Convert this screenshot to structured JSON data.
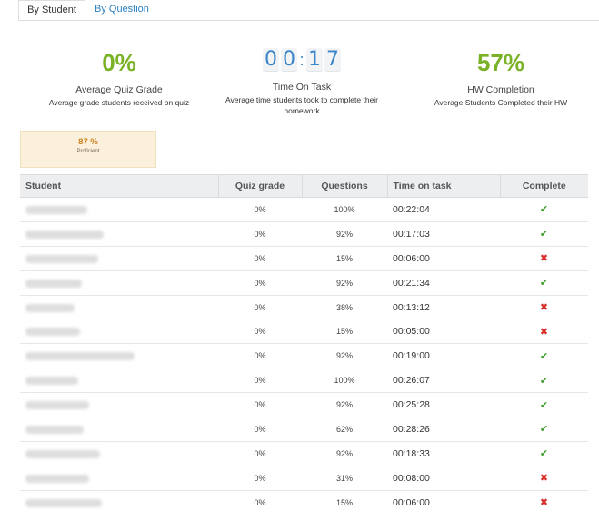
{
  "tabs": {
    "by_student": "By Student",
    "by_question": "By Question"
  },
  "stats": {
    "quiz": {
      "value": "0%",
      "title": "Average Quiz Grade",
      "subtitle": "Average grade students received on quiz"
    },
    "time": {
      "digits": [
        "0",
        "0",
        "1",
        "7"
      ],
      "title": "Time On Task",
      "subtitle": "Average time students took to complete their homework"
    },
    "hw": {
      "value": "57%",
      "title": "HW Completion",
      "subtitle": "Average Students Completed their HW"
    }
  },
  "proficiency": {
    "percent": "87 %",
    "label": "Proficient"
  },
  "table": {
    "headers": [
      "Student",
      "Quiz grade",
      "Questions",
      "Time on task",
      "Complete"
    ],
    "rows": [
      {
        "quiz": "0%",
        "questions": "100%",
        "time": "00:22:04",
        "complete": true
      },
      {
        "quiz": "0%",
        "questions": "92%",
        "time": "00:17:03",
        "complete": true
      },
      {
        "quiz": "0%",
        "questions": "15%",
        "time": "00:06:00",
        "complete": false
      },
      {
        "quiz": "0%",
        "questions": "92%",
        "time": "00:21:34",
        "complete": true
      },
      {
        "quiz": "0%",
        "questions": "38%",
        "time": "00:13:12",
        "complete": false
      },
      {
        "quiz": "0%",
        "questions": "15%",
        "time": "00:05:00",
        "complete": false
      },
      {
        "quiz": "0%",
        "questions": "92%",
        "time": "00:19:00",
        "complete": true
      },
      {
        "quiz": "0%",
        "questions": "100%",
        "time": "00:26:07",
        "complete": true
      },
      {
        "quiz": "0%",
        "questions": "92%",
        "time": "00:25:28",
        "complete": true
      },
      {
        "quiz": "0%",
        "questions": "62%",
        "time": "00:28:26",
        "complete": true
      },
      {
        "quiz": "0%",
        "questions": "92%",
        "time": "00:18:33",
        "complete": true
      },
      {
        "quiz": "0%",
        "questions": "31%",
        "time": "00:08:00",
        "complete": false
      },
      {
        "quiz": "0%",
        "questions": "15%",
        "time": "00:06:00",
        "complete": false
      }
    ]
  },
  "icons": {
    "complete": "checkmark-icon",
    "incomplete": "x-icon"
  },
  "colors": {
    "accent_green": "#7ab227",
    "link_blue": "#2a7fc1",
    "check_green": "#3c9a2a",
    "cross_red": "#d9302c"
  }
}
